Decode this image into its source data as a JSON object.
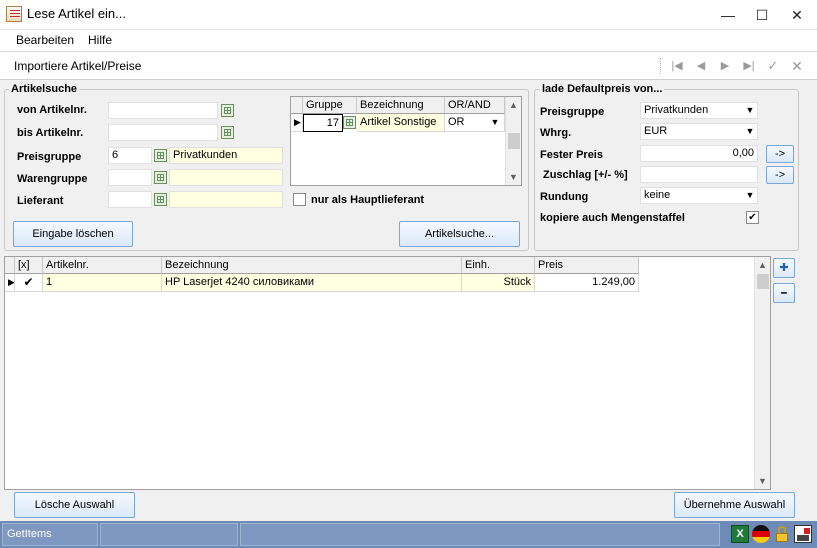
{
  "window": {
    "title": "Lese Artikel ein...",
    "min_glyph": "—",
    "max_glyph": "☐",
    "close_glyph": "✕"
  },
  "menu": {
    "items": [
      "Bearbeiten",
      "Hilfe"
    ]
  },
  "toolbar": {
    "title": "Importiere Artikel/Preise",
    "nav": {
      "first": "|◀",
      "prev": "◀",
      "next": "▶",
      "last": "▶|",
      "confirm": "✓",
      "cancel": "✕"
    }
  },
  "artikelsuche": {
    "title": "Artikelsuche",
    "von_label": "von Artikelnr.",
    "von_value": "",
    "bis_label": "bis Artikelnr.",
    "bis_value": "",
    "preisgruppe_label": "Preisgruppe",
    "preisgruppe_value": "6",
    "preisgruppe_name": "Privatkunden",
    "warengruppe_label": "Warengruppe",
    "warengruppe_value": "",
    "warengruppe_name": "",
    "lieferant_label": "Lieferant",
    "lieferant_value": "",
    "lieferant_name": "",
    "hauptlieferant_label": "nur als Hauptlieferant",
    "hauptlieferant_checked": false,
    "reset_button": "Eingabe löschen",
    "search_button": "Artikelsuche...",
    "group_grid": {
      "columns": [
        "Gruppe",
        "Bezeichnung",
        "OR/AND"
      ],
      "rows": [
        {
          "gruppe": "17",
          "bezeichnung": "Artikel Sonstige",
          "orand": "OR"
        }
      ]
    }
  },
  "defaultpreis": {
    "title": "lade Defaultpreis von...",
    "preisgruppe_label": "Preisgruppe",
    "preisgruppe_value": "Privatkunden",
    "whrg_label": "Whrg.",
    "whrg_value": "EUR",
    "fester_label": "Fester Preis",
    "fester_value": "0,00",
    "fester_btn": "->",
    "zuschlag_label": "Zuschlag [+/- %]",
    "zuschlag_value": "",
    "zuschlag_btn": "->",
    "rundung_label": "Rundung",
    "rundung_value": "keine",
    "mengenstaffel_label": "kopiere auch Mengenstaffel",
    "mengenstaffel_checked": true
  },
  "result_grid": {
    "columns": [
      "[x]",
      "Artikelnr.",
      "Bezeichnung",
      "Einh.",
      "Preis"
    ],
    "rows": [
      {
        "checked": "✔",
        "artikelnr": "1",
        "bezeichnung": "HP Laserjet 4240 силовиками",
        "einh": "Stück",
        "preis": "1.249,00"
      }
    ],
    "add_glyph": "✚",
    "remove_glyph": "━"
  },
  "bottom": {
    "clear_button": "Lösche Auswahl",
    "accept_button": "Übernehme Auswahl"
  },
  "status": {
    "panel1": "GetItems"
  },
  "colors": {
    "accent": "#7aa7d8",
    "statusbar": "#6e8bb8",
    "highlight": "#ffffe1"
  }
}
